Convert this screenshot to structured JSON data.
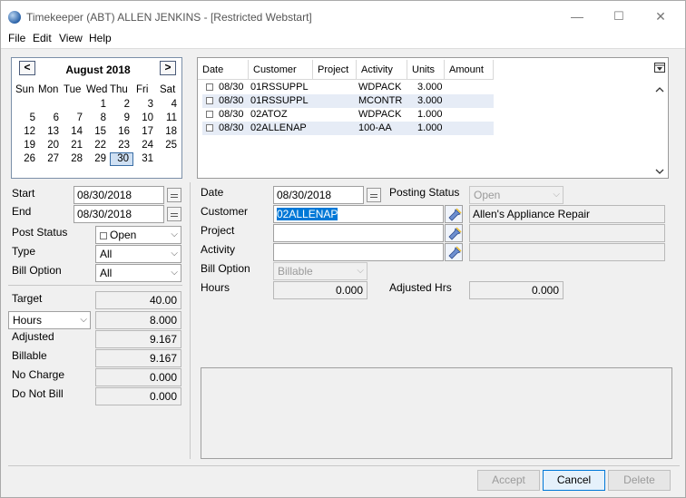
{
  "window": {
    "title": "Timekeeper (ABT) ALLEN JENKINS - [Restricted Webstart]",
    "controls": {
      "minimize": "—",
      "maximize": "☐",
      "close": "✕"
    }
  },
  "menu": [
    "File",
    "Edit",
    "View",
    "Help"
  ],
  "calendar": {
    "title": "August 2018",
    "prev": "<",
    "next": ">",
    "dow": [
      "Sun",
      "Mon",
      "Tue",
      "Wed",
      "Thu",
      "Fri",
      "Sat"
    ],
    "weeks": [
      [
        "",
        "",
        "",
        "1",
        "2",
        "3",
        "4"
      ],
      [
        "5",
        "6",
        "7",
        "8",
        "9",
        "10",
        "11"
      ],
      [
        "12",
        "13",
        "14",
        "15",
        "16",
        "17",
        "18"
      ],
      [
        "19",
        "20",
        "21",
        "22",
        "23",
        "24",
        "25"
      ],
      [
        "26",
        "27",
        "28",
        "29",
        "30",
        "31",
        ""
      ]
    ],
    "selected_day": "30"
  },
  "filters": {
    "start_label": "Start",
    "start_value": "08/30/2018",
    "end_label": "End",
    "end_value": "08/30/2018",
    "post_status_label": "Post Status",
    "post_status_value": "Open",
    "type_label": "Type",
    "type_value": "All",
    "bill_option_label": "Bill Option",
    "bill_option_value": "All"
  },
  "totals": {
    "target_label": "Target",
    "target_value": "40.00",
    "unit_select": "Hours",
    "unit_value": "8.000",
    "adjusted_label": "Adjusted",
    "adjusted_value": "9.167",
    "billable_label": "Billable",
    "billable_value": "9.167",
    "no_charge_label": "No Charge",
    "no_charge_value": "0.000",
    "do_not_bill_label": "Do Not Bill",
    "do_not_bill_value": "0.000"
  },
  "grid": {
    "columns": [
      "Date",
      "Customer",
      "Project",
      "Activity",
      "Units",
      "Amount"
    ],
    "rows": [
      {
        "date": "08/30",
        "customer": "01RSSUPPL",
        "project": "",
        "activity": "WDPACK",
        "units": "3.000",
        "amount": ""
      },
      {
        "date": "08/30",
        "customer": "01RSSUPPL",
        "project": "",
        "activity": "MCONTR",
        "units": "3.000",
        "amount": ""
      },
      {
        "date": "08/30",
        "customer": "02ATOZ",
        "project": "",
        "activity": "WDPACK",
        "units": "1.000",
        "amount": ""
      },
      {
        "date": "08/30",
        "customer": "02ALLENAP",
        "project": "",
        "activity": "100-AA",
        "units": "1.000",
        "amount": ""
      }
    ]
  },
  "detail": {
    "date_label": "Date",
    "date_value": "08/30/2018",
    "posting_status_label": "Posting Status",
    "posting_status_value": "Open",
    "customer_label": "Customer",
    "customer_value": "02ALLENAP",
    "customer_name": "Allen's Appliance Repair",
    "project_label": "Project",
    "project_value": "",
    "project_name": "",
    "activity_label": "Activity",
    "activity_value": "",
    "activity_name": "",
    "bill_option_label": "Bill Option",
    "bill_option_value": "Billable",
    "hours_label": "Hours",
    "hours_value": "0.000",
    "adjusted_hrs_label": "Adjusted Hrs",
    "adjusted_hrs_value": "0.000"
  },
  "buttons": {
    "accept": "Accept",
    "cancel": "Cancel",
    "delete": "Delete"
  },
  "colors": {
    "selection": "#0078d7",
    "grid_alt_row": "#e6ecf6",
    "calendar_selected": "#cfe0f3"
  }
}
